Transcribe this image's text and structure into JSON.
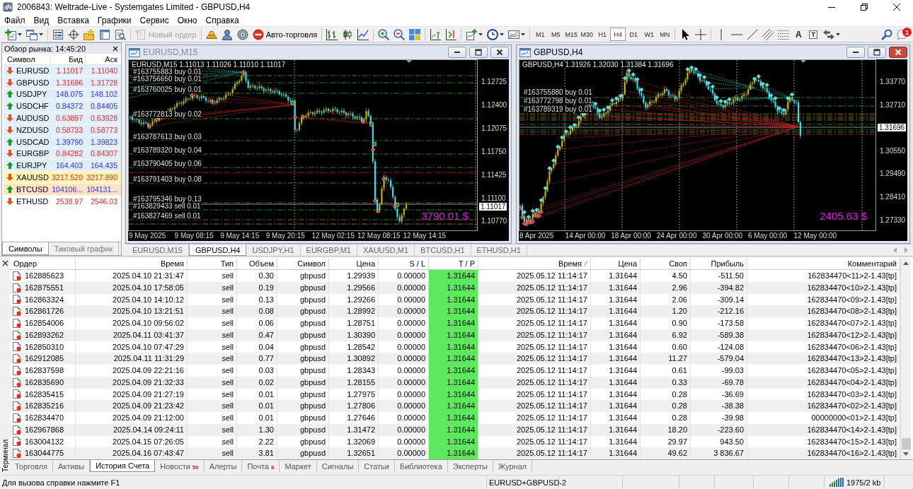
{
  "window": {
    "title": "2006843: Weltrade-Live - Systemgates Limited - GBPUSD,H4"
  },
  "menu": [
    "Файл",
    "Вид",
    "Вставка",
    "Графики",
    "Сервис",
    "Окно",
    "Справка"
  ],
  "toolbar": {
    "buttons": [
      {
        "label": "Новый ордер",
        "disabled": true
      },
      {
        "label": "Авто-торговля",
        "disabled": false
      }
    ],
    "timeframes": [
      {
        "label": "M1",
        "selected": false
      },
      {
        "label": "M5",
        "selected": false
      },
      {
        "label": "M15",
        "selected": false
      },
      {
        "label": "M30",
        "selected": false
      },
      {
        "label": "H1",
        "selected": false
      },
      {
        "label": "H4",
        "selected": true
      },
      {
        "label": "D1",
        "selected": false
      },
      {
        "label": "W1",
        "selected": false
      },
      {
        "label": "MN",
        "selected": false
      }
    ],
    "text_tools": [
      {
        "glyph": "A",
        "kind": "text"
      },
      {
        "glyph": "T",
        "kind": "label"
      }
    ],
    "notification_count": "1"
  },
  "market_watch": {
    "title": "Обзор рынка: 14:45:20",
    "columns": [
      "Символ",
      "Бид",
      "Аск"
    ],
    "rows": [
      {
        "symbol": "EURUSD",
        "bid": "1.11017",
        "ask": "1.11040",
        "rising": false,
        "color": "#e1effc"
      },
      {
        "symbol": "GBPUSD",
        "bid": "1.31696",
        "ask": "1.31728",
        "rising": false,
        "color": "#e1effc"
      },
      {
        "symbol": "USDJPY",
        "bid": "148.075",
        "ask": "148.102",
        "rising": true,
        "color": "#e1effc"
      },
      {
        "symbol": "USDCHF",
        "bid": "0.84372",
        "ask": "0.84405",
        "rising": true,
        "color": "#e1effc"
      },
      {
        "symbol": "AUDUSD",
        "bid": "0.63897",
        "ask": "0.63928",
        "rising": false,
        "color": "#e1effc"
      },
      {
        "symbol": "NZDUSD",
        "bid": "0.58733",
        "ask": "0.58773",
        "rising": false,
        "color": "#e1effc"
      },
      {
        "symbol": "USDCAD",
        "bid": "1.39790",
        "ask": "1.39823",
        "rising": true,
        "color": "#e1effc"
      },
      {
        "symbol": "EURGBP",
        "bid": "0.84282",
        "ask": "0.84307",
        "rising": false,
        "color": "#e1effc"
      },
      {
        "symbol": "EURJPY",
        "bid": "164.403",
        "ask": "164.435",
        "rising": true,
        "color": "#e1effc"
      },
      {
        "symbol": "XAUUSD",
        "bid": "3217.520",
        "ask": "3217.890",
        "rising": false,
        "color": "#fff4b0"
      },
      {
        "symbol": "BTCUSD",
        "bid": "104106...",
        "ask": "104131...",
        "rising": true,
        "color": "#fde2c6"
      },
      {
        "symbol": "ETHUSD",
        "bid": "2538.97",
        "ask": "2546.03",
        "rising": false,
        "color": "#ffffff"
      }
    ],
    "tabs": [
      {
        "label": "Символы",
        "selected": true
      },
      {
        "label": "Тиковый график",
        "selected": false
      }
    ]
  },
  "charts": [
    {
      "title": "EURUSD,M15",
      "active": false,
      "header": "EURUSD,M15 1.11013 1.11026 1.11010 1.11017",
      "order_labels": [
        "#163755883 buy 0.01",
        "#163756650 buy 0.01",
        "#163760025 buy 0.01",
        "#163772813 buy 0.02",
        "#163787613 buy 0.03",
        "#163789320 buy 0.04",
        "#163790405 buy 0.06",
        "#163791403 buy 0.08",
        "#163795346 buy 0.13",
        "#163829433 sell 0.01",
        "#163827469 sell 0.01"
      ],
      "profit": "3790.01 $",
      "price_axis": [
        "1.12725",
        "1.12400",
        "1.12075",
        "1.11750",
        "1.11425",
        "1.11100",
        "1.10770"
      ],
      "current_price": "1.11017",
      "time_axis": [
        "9 May 2025",
        "9 May 08:15",
        "9 May 14:15",
        "9 May 20:15",
        "12 May 02:15",
        "12 May 08:15",
        "12 May 14:15"
      ]
    },
    {
      "title": "GBPUSD,H4",
      "active": true,
      "header": "GBPUSD,H4 1.31926 1.32030 1.31384 1.31696",
      "order_labels": [
        "#163755880 buy 0.01",
        "#163772798 buy 0.01",
        "#163789319 buy 0.01"
      ],
      "profit": "2405.63 $",
      "price_axis": [
        "1.33770",
        "1.32710",
        "1.30550",
        "1.29490",
        "1.28410",
        "1.27330"
      ],
      "current_price": "1.31696",
      "time_axis": [
        "8 Apr 2025",
        "14 Apr 00:00",
        "18 Apr 00:00",
        "24 Apr 00:00",
        "30 Apr 00:00",
        "6 May 00:00",
        "12 May 00:00"
      ]
    }
  ],
  "chart_tabs": [
    {
      "label": "EURUSD,M15",
      "selected": false
    },
    {
      "label": "GBPUSD,H4",
      "selected": true
    },
    {
      "label": "USDJPY,H1",
      "selected": false
    },
    {
      "label": "EURGBP,M1",
      "selected": false
    },
    {
      "label": "XAUUSD,M1",
      "selected": false
    },
    {
      "label": "BTCUSD,H1",
      "selected": false
    },
    {
      "label": "ETHUSD,H1",
      "selected": false
    }
  ],
  "terminal": {
    "label": "Терминал",
    "columns": [
      {
        "label": "Ордер",
        "sorted": false
      },
      {
        "label": "Время",
        "sorted": false
      },
      {
        "label": "Тип",
        "sorted": false
      },
      {
        "label": "Объем",
        "sorted": false
      },
      {
        "label": "Символ",
        "sorted": false
      },
      {
        "label": "Цена",
        "sorted": false
      },
      {
        "label": "S / L",
        "sorted": false
      },
      {
        "label": "T / P",
        "sorted": false
      },
      {
        "label": "Время",
        "sorted": true
      },
      {
        "label": "Цена",
        "sorted": false
      },
      {
        "label": "Своп",
        "sorted": false
      },
      {
        "label": "Прибыль",
        "sorted": false
      },
      {
        "label": "Комментарий",
        "sorted": false
      }
    ],
    "rows": [
      {
        "order": "162885623",
        "open_time": "2025.04.10 21:31:47",
        "type": "sell",
        "volume": "0.30",
        "symbol": "gbpusd",
        "price": "1.29939",
        "sl": "0.00000",
        "tp": "1.31644",
        "tp_hit": true,
        "close_time": "2025.05.12 11:14:17",
        "close_price": "1.31644",
        "swap": "4.50",
        "profit": "-511.50",
        "comment": "162834470<11>2-1.43[tp]"
      },
      {
        "order": "162875551",
        "open_time": "2025.04.10 17:58:05",
        "type": "sell",
        "volume": "0.19",
        "symbol": "gbpusd",
        "price": "1.29566",
        "sl": "0.00000",
        "tp": "1.31644",
        "tp_hit": true,
        "close_time": "2025.05.12 11:14:17",
        "close_price": "1.31644",
        "swap": "2.96",
        "profit": "-394.82",
        "comment": "162834470<10>2-1.43[tp]"
      },
      {
        "order": "162863324",
        "open_time": "2025.04.10 14:10:12",
        "type": "sell",
        "volume": "0.13",
        "symbol": "gbpusd",
        "price": "1.29266",
        "sl": "0.00000",
        "tp": "1.31644",
        "tp_hit": true,
        "close_time": "2025.05.12 11:14:17",
        "close_price": "1.31644",
        "swap": "2.06",
        "profit": "-309.14",
        "comment": "162834470<09>2-1.43[tp]"
      },
      {
        "order": "162861726",
        "open_time": "2025.04.10 13:21:51",
        "type": "sell",
        "volume": "0.08",
        "symbol": "gbpusd",
        "price": "1.28992",
        "sl": "0.00000",
        "tp": "1.31644",
        "tp_hit": true,
        "close_time": "2025.05.12 11:14:17",
        "close_price": "1.31644",
        "swap": "1.20",
        "profit": "-212.16",
        "comment": "162834470<08>2-1.43[tp]"
      },
      {
        "order": "162854006",
        "open_time": "2025.04.10 09:56:02",
        "type": "sell",
        "volume": "0.06",
        "symbol": "gbpusd",
        "price": "1.28751",
        "sl": "0.00000",
        "tp": "1.31644",
        "tp_hit": true,
        "close_time": "2025.05.12 11:14:17",
        "close_price": "1.31644",
        "swap": "0.90",
        "profit": "-173.58",
        "comment": "162834470<07>2-1.43[tp]"
      },
      {
        "order": "162893262",
        "open_time": "2025.04.11 03:41:37",
        "type": "sell",
        "volume": "0.47",
        "symbol": "gbpusd",
        "price": "1.30390",
        "sl": "0.00000",
        "tp": "1.31644",
        "tp_hit": true,
        "close_time": "2025.05.12 11:14:17",
        "close_price": "1.31644",
        "swap": "6.92",
        "profit": "-589.38",
        "comment": "162834470<12>2-1.43[tp]"
      },
      {
        "order": "162850310",
        "open_time": "2025.04.10 07:47:29",
        "type": "sell",
        "volume": "0.04",
        "symbol": "gbpusd",
        "price": "1.28542",
        "sl": "0.00000",
        "tp": "1.31644",
        "tp_hit": true,
        "close_time": "2025.05.12 11:14:17",
        "close_price": "1.31644",
        "swap": "0.60",
        "profit": "-124.08",
        "comment": "162834470<06>2-1.43[tp]"
      },
      {
        "order": "162912085",
        "open_time": "2025.04.11 11:31:29",
        "type": "sell",
        "volume": "0.77",
        "symbol": "gbpusd",
        "price": "1.30892",
        "sl": "0.00000",
        "tp": "1.31644",
        "tp_hit": true,
        "close_time": "2025.05.12 11:14:17",
        "close_price": "1.31644",
        "swap": "11.27",
        "profit": "-579.04",
        "comment": "162834470<13>2-1.43[tp]"
      },
      {
        "order": "162837598",
        "open_time": "2025.04.09 22:21:16",
        "type": "sell",
        "volume": "0.03",
        "symbol": "gbpusd",
        "price": "1.28343",
        "sl": "0.00000",
        "tp": "1.31644",
        "tp_hit": true,
        "close_time": "2025.05.12 11:14:17",
        "close_price": "1.31644",
        "swap": "0.61",
        "profit": "-99.03",
        "comment": "162834470<05>2-1.43[tp]"
      },
      {
        "order": "162835690",
        "open_time": "2025.04.09 21:32:33",
        "type": "sell",
        "volume": "0.02",
        "symbol": "gbpusd",
        "price": "1.28155",
        "sl": "0.00000",
        "tp": "1.31644",
        "tp_hit": true,
        "close_time": "2025.05.12 11:14:17",
        "close_price": "1.31644",
        "swap": "0.33",
        "profit": "-69.78",
        "comment": "162834470<04>2-1.43[tp]"
      },
      {
        "order": "162835415",
        "open_time": "2025.04.09 21:27:19",
        "type": "sell",
        "volume": "0.01",
        "symbol": "gbpusd",
        "price": "1.27975",
        "sl": "0.00000",
        "tp": "1.31644",
        "tp_hit": true,
        "close_time": "2025.05.12 11:14:17",
        "close_price": "1.31644",
        "swap": "0.28",
        "profit": "-36.69",
        "comment": "162834470<03>2-1.43[tp]"
      },
      {
        "order": "162835216",
        "open_time": "2025.04.09 21:23:42",
        "type": "sell",
        "volume": "0.01",
        "symbol": "gbpusd",
        "price": "1.27806",
        "sl": "0.00000",
        "tp": "1.31644",
        "tp_hit": true,
        "close_time": "2025.05.12 11:14:17",
        "close_price": "1.31644",
        "swap": "0.28",
        "profit": "-38.38",
        "comment": "162834470<02>2-1.43[tp]"
      },
      {
        "order": "162834470",
        "open_time": "2025.04.09 21:12:00",
        "type": "sell",
        "volume": "0.01",
        "symbol": "gbpusd",
        "price": "1.27646",
        "sl": "0.00000",
        "tp": "1.31644",
        "tp_hit": true,
        "close_time": "2025.05.12 11:14:17",
        "close_price": "1.31644",
        "swap": "0.28",
        "profit": "-39.98",
        "comment": "00000000<01>2-1.43[tp]"
      },
      {
        "order": "162967868",
        "open_time": "2025.04.14 09:24:11",
        "type": "sell",
        "volume": "1.30",
        "symbol": "gbpusd",
        "price": "1.31472",
        "sl": "0.00000",
        "tp": "1.31644",
        "tp_hit": true,
        "close_time": "2025.05.12 11:14:17",
        "close_price": "1.31644",
        "swap": "18.20",
        "profit": "-223.60",
        "comment": "162834470<14>2-1.43[tp]"
      },
      {
        "order": "163004132",
        "open_time": "2025.04.15 07:26:05",
        "type": "sell",
        "volume": "2.22",
        "symbol": "gbpusd",
        "price": "1.32069",
        "sl": "0.00000",
        "tp": "1.31644",
        "tp_hit": true,
        "close_time": "2025.05.12 11:14:17",
        "close_price": "1.31644",
        "swap": "29.97",
        "profit": "943.50",
        "comment": "162834470<15>2-1.43[tp]"
      },
      {
        "order": "163044775",
        "open_time": "2025.04.16 07:43:47",
        "type": "sell",
        "volume": "3.81",
        "symbol": "gbpusd",
        "price": "1.32651",
        "sl": "0.00000",
        "tp": "1.31644",
        "tp_hit": true,
        "close_time": "2025.05.12 11:14:17",
        "close_price": "1.31644",
        "swap": "49.62",
        "profit": "3 836.67",
        "comment": "162834470<16>2-1.43[tp]"
      }
    ],
    "tabs": [
      {
        "label": "Торговля",
        "selected": false
      },
      {
        "label": "Активы",
        "selected": false
      },
      {
        "label": "История Счета",
        "selected": true
      },
      {
        "label": "Новости",
        "count": "50",
        "selected": false
      },
      {
        "label": "Алерты",
        "selected": false
      },
      {
        "label": "Почта",
        "count": "6",
        "selected": false
      },
      {
        "label": "Маркет",
        "selected": false
      },
      {
        "label": "Сигналы",
        "selected": false
      },
      {
        "label": "Статьи",
        "selected": false
      },
      {
        "label": "Библиотека",
        "selected": false
      },
      {
        "label": "Эксперты",
        "selected": false
      },
      {
        "label": "Журнал",
        "selected": false
      }
    ]
  },
  "status_bar": {
    "help": "Для вызова справки нажмите F1",
    "profile": "EURUSD+GBPUSD-2",
    "traffic": "1975/2 kb"
  }
}
